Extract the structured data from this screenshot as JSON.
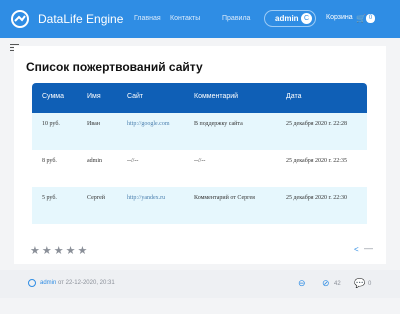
{
  "header": {
    "brand": "DataLife Engine",
    "nav": [
      "Главная",
      "Контакты",
      "Правила"
    ],
    "user": {
      "name": "admin",
      "badge": "C"
    },
    "cart": {
      "label": "Корзина",
      "count": "0"
    }
  },
  "page": {
    "title": "Список пожертвований сайту",
    "table": {
      "headers": [
        "Сумма",
        "Имя",
        "Сайт",
        "Комментарий",
        "Дата"
      ],
      "rows": [
        [
          "10 руб.",
          "Иван",
          "http://google.com",
          "В поддержку сайта",
          "25 декабря 2020 г. 22:28"
        ],
        [
          "8 руб.",
          "admin",
          "--//--",
          "--//--",
          "25 декабря 2020 г. 22:35"
        ],
        [
          "5 руб.",
          "Сергей",
          "http://yandex.ru",
          "Комментарий от Сергея",
          "25 декабря 2020 г. 22:30"
        ]
      ]
    },
    "rating": "★★★★★",
    "more": "—"
  },
  "footer": {
    "author": "admin",
    "date_text": " от 22-12-2020, 20:31",
    "views": "42",
    "comments": "0"
  }
}
